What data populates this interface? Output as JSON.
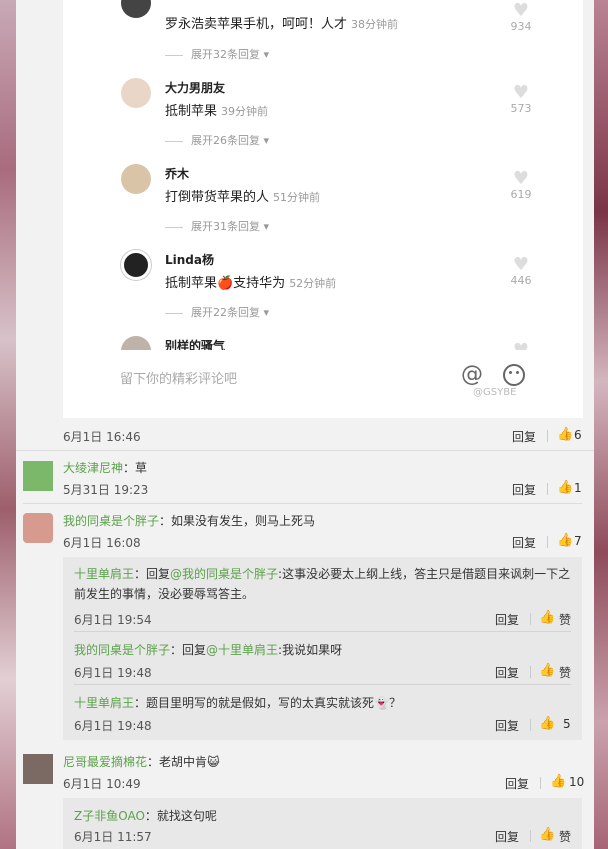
{
  "embedded": {
    "comments": [
      {
        "name": "",
        "text": "罗永浩卖苹果手机，呵呵！人才",
        "time": "38分钟前",
        "expand": "展开32条回复",
        "likes": "934"
      },
      {
        "name": "大力男朋友",
        "text": "抵制苹果",
        "time": "39分钟前",
        "expand": "展开26条回复",
        "likes": "573"
      },
      {
        "name": "乔木",
        "text": "打倒带货苹果的人",
        "time": "51分钟前",
        "expand": "展开31条回复",
        "likes": "619"
      },
      {
        "name": "Linda杨",
        "text": "抵制苹果🍎支持华为",
        "time": "52分钟前",
        "expand": "展开22条回复",
        "likes": "446"
      },
      {
        "name": "别样的骚气"
      }
    ],
    "input_placeholder": "留下你的精彩评论吧",
    "watermark": "@GSYBE"
  },
  "post_meta": {
    "date": "6月1日 16:46",
    "reply": "回复",
    "likes": "6"
  },
  "comments": [
    {
      "user": "大绫津尼神",
      "text": "：草",
      "date": "5月31日 19:23",
      "reply": "回复",
      "likes": "1"
    },
    {
      "user": "我的同桌是个胖子",
      "text": "：如果没有发生，则马上死马",
      "date": "6月1日 16:08",
      "reply": "回复",
      "likes": "7",
      "replies": [
        {
          "user": "十里单肩王",
          "text_prefix": "：回复",
          "mention": "@我的同桌是个胖子",
          "text": ":这事没必要太上纲上线，答主只是借题目来讽刺一下之前发生的事情，没必要辱骂答主。",
          "date": "6月1日 19:54",
          "reply": "回复",
          "likes": "赞"
        },
        {
          "user": "我的同桌是个胖子",
          "text_prefix": "：回复",
          "mention": "@十里单肩王",
          "text": ":我说如果呀",
          "date": "6月1日 19:48",
          "reply": "回复",
          "likes": "赞"
        },
        {
          "user": "十里单肩王",
          "text_prefix": "",
          "mention": "",
          "text": "：题目里明写的就是假如，写的太真实就该死👻？",
          "date": "6月1日 19:48",
          "reply": "回复",
          "likes": "5"
        }
      ]
    },
    {
      "user": "尼哥最爱摘棉花",
      "text": "：老胡中肯😺",
      "date": "6月1日 10:49",
      "reply": "回复",
      "likes": "10",
      "replies": [
        {
          "user": "Z子非鱼OAO",
          "text_prefix": "",
          "mention": "",
          "text": "：就找这句呢",
          "date": "6月1日 11:57",
          "reply": "回复",
          "likes": "赞"
        }
      ]
    }
  ]
}
